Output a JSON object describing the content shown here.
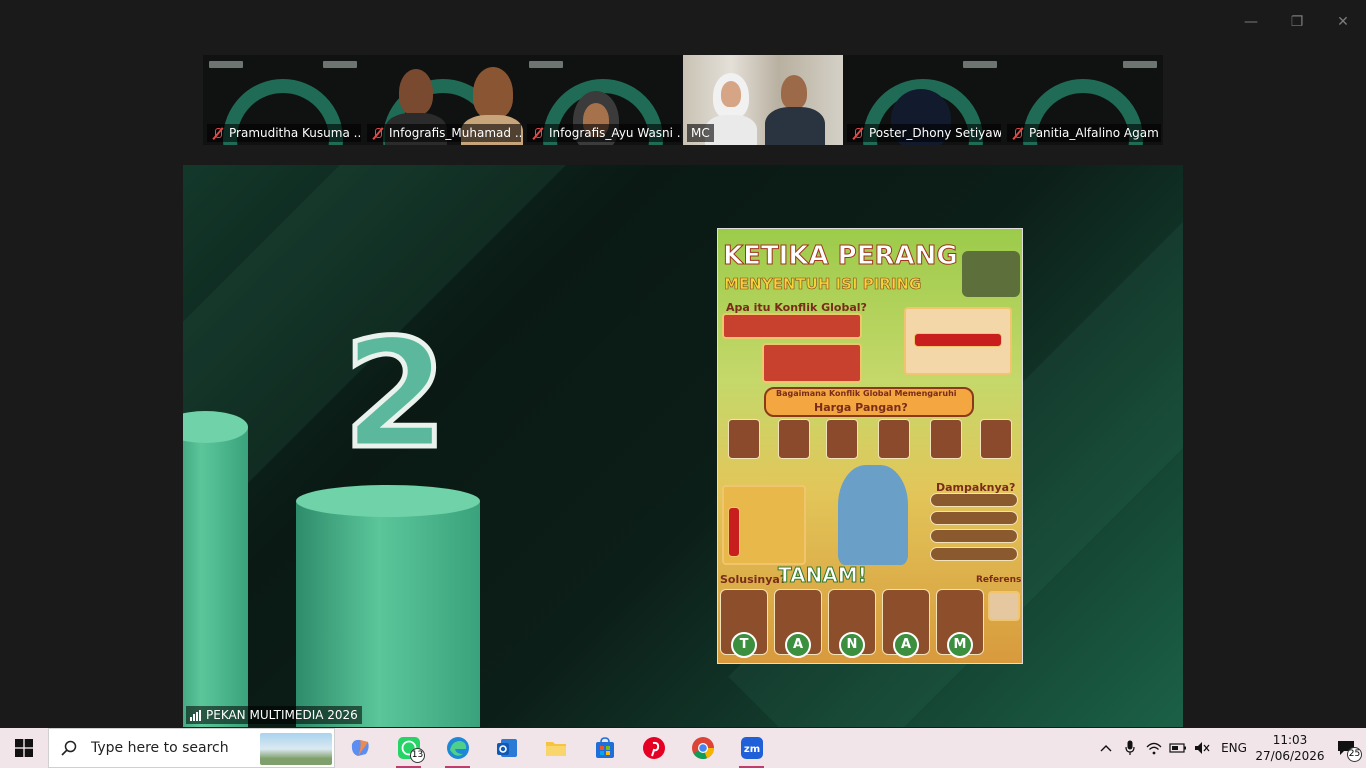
{
  "window_controls": {
    "minimize": "—",
    "restore": "❐",
    "close": "✕"
  },
  "participants": [
    {
      "name": "Pramuditha Kusuma ...",
      "muted": true
    },
    {
      "name": "Infografis_Muhamad ...",
      "muted": true
    },
    {
      "name": "Infografis_Ayu Wasni ...",
      "muted": true
    },
    {
      "name": "MC",
      "muted": false
    },
    {
      "name": "Poster_Dhony Setiyaw...",
      "muted": true
    },
    {
      "name": "Panitia_Alfalino Agam",
      "muted": true
    }
  ],
  "share": {
    "rank_number": "2",
    "host_label": "PEKAN MULTIMEDIA 2026",
    "poster": {
      "title": "KETIKA PERANG",
      "subtitle": "MENYENTUH ISI PIRING",
      "q1": "Apa itu Konflik Global?",
      "q2": "Bagaimana Konflik Global Memengaruhi",
      "q2b": "Harga Pangan?",
      "impact": "Dampaknya?",
      "solution": "Solusinya?",
      "solution_word": "TANAM!",
      "reference": "Referensi:",
      "letters": [
        "T",
        "A",
        "N",
        "A",
        "M"
      ]
    }
  },
  "taskbar": {
    "search_placeholder": "Type here to search",
    "whatsapp_badge": "13",
    "tray": {
      "language": "ENG",
      "time": "11:03",
      "date": "27/06/2026",
      "notification_count": "25"
    }
  },
  "colors": {
    "accent_green": "#1f6b55",
    "muted_red": "#e24a4a",
    "taskbar_bg": "#f1e5ea",
    "active_underline": "#c23b6d"
  }
}
